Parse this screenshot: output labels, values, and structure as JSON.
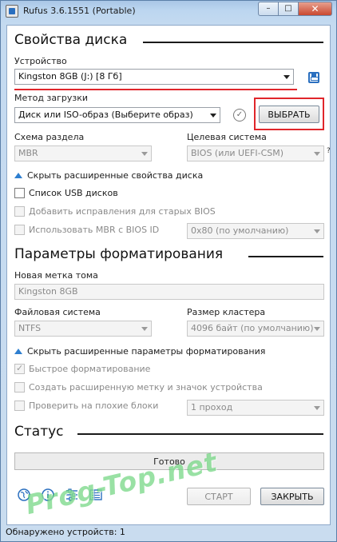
{
  "window": {
    "title": "Rufus 3.6.1551 (Portable)",
    "minimize_glyph": "–",
    "maximize_glyph": "□",
    "close_glyph": "✕"
  },
  "drive_properties": {
    "heading": "Свойства диска",
    "device_label": "Устройство",
    "device_value": "Kingston 8GB (J:) [8 Гб]",
    "boot_selection_label": "Метод загрузки",
    "boot_selection_value": "Диск или ISO-образ (Выберите образ)",
    "select_button": "ВЫБРАТЬ",
    "partition_scheme_label": "Схема раздела",
    "partition_scheme_value": "MBR",
    "target_system_label": "Целевая система",
    "target_system_value": "BIOS (или UEFI-CSM)",
    "target_help": "?",
    "advanced_toggle": "Скрыть расширенные свойства диска",
    "list_usb_label": "Список USB дисков",
    "old_bios_fixes_label": "Добавить исправления для старых BIOS",
    "use_mbr_bios_id_label": "Использовать MBR с BIOS ID",
    "bios_id_value": "0x80 (по умолчанию)"
  },
  "format_options": {
    "heading": "Параметры форматирования",
    "volume_label_label": "Новая метка тома",
    "volume_label_value": "Kingston 8GB",
    "file_system_label": "Файловая система",
    "file_system_value": "NTFS",
    "cluster_size_label": "Размер кластера",
    "cluster_size_value": "4096 байт (по умолчанию)",
    "advanced_toggle": "Скрыть расширенные параметры форматирования",
    "quick_format_label": "Быстрое форматирование",
    "extended_label_label": "Создать расширенную метку и значок устройства",
    "bad_blocks_label": "Проверить на плохие блоки",
    "passes_value": "1 проход"
  },
  "status": {
    "heading": "Статус",
    "progress_text": "Готово",
    "start_button": "СТАРТ",
    "close_button": "ЗАКРЫТЬ",
    "status_bar_text": "Обнаружено устройств: 1"
  },
  "watermark": "Prog-Top.net",
  "colors": {
    "highlight": "#e0262b",
    "accent": "#2a6fbf",
    "toggle_arrow": "#2e7fd0"
  },
  "icons": [
    "globe-icon",
    "info-icon",
    "settings-sliders-icon",
    "log-icon",
    "save-icon",
    "check-circle-icon"
  ]
}
